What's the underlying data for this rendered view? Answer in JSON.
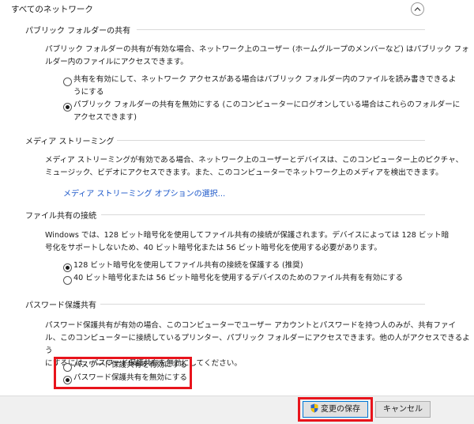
{
  "header": {
    "title": "すべてのネットワーク",
    "collapse_icon": "chevron-up-icon"
  },
  "public_folder_sharing": {
    "title": "パブリック フォルダーの共有",
    "description_lines": [
      "パブリック フォルダーの共有が有効な場合、ネットワーク上のユーザー (ホームグループのメンバーなど) はパブリック フォ",
      "ルダー内のファイルにアクセスできます。"
    ],
    "option_on_lines": [
      "共有を有効にして、ネットワーク アクセスがある場合はパブリック フォルダー内のファイルを読み書きできるよ",
      "うにする"
    ],
    "option_off_lines": [
      "パブリック フォルダーの共有を無効にする (このコンピューターにログオンしている場合はこれらのフォルダーに",
      "アクセスできます)"
    ],
    "selected": "off"
  },
  "media_streaming": {
    "title": "メディア ストリーミング",
    "description_lines": [
      "メディア ストリーミングが有効である場合、ネットワーク上のユーザーとデバイスは、このコンピューター上のピクチャ、",
      "ミュージック、ビデオにアクセスできます。また、このコンピューターでネットワーク上のメディアを検出できます。"
    ],
    "link": "メディア ストリーミング オプションの選択..."
  },
  "file_sharing_connections": {
    "title": "ファイル共有の接続",
    "description_lines": [
      "Windows では、128 ビット暗号化を使用してファイル共有の接続が保護されます。デバイスによっては 128 ビット暗",
      "号化をサポートしないため、40 ビット暗号化または 56 ビット暗号化を使用する必要があります。"
    ],
    "option_128": "128 ビット暗号化を使用してファイル共有の接続を保護する (推奨)",
    "option_40_56": "40 ビット暗号化または 56 ビット暗号化を使用するデバイスのためのファイル共有を有効にする",
    "selected": "128"
  },
  "password_protected_sharing": {
    "title": "パスワード保護共有",
    "description_lines": [
      "パスワード保護共有が有効の場合、このコンピューターでユーザー アカウントとパスワードを持つ人のみが、共有ファイ",
      "ル、このコンピューターに接続しているプリンター、パブリック フォルダーにアクセスできます。他の人がアクセスできるよう",
      "にするには、パスワード保護共有を無効にしてください。"
    ],
    "option_on": "パスワード保護共有を有効にする",
    "option_off": "パスワード保護共有を無効にする",
    "selected": "off"
  },
  "footer": {
    "save_label": "変更の保存",
    "save_icon": "uac-shield-icon",
    "cancel_label": "キャンセル"
  },
  "colors": {
    "highlight": "#e8141c",
    "link": "#1a56c9",
    "primary_button_border": "#0078d7"
  }
}
